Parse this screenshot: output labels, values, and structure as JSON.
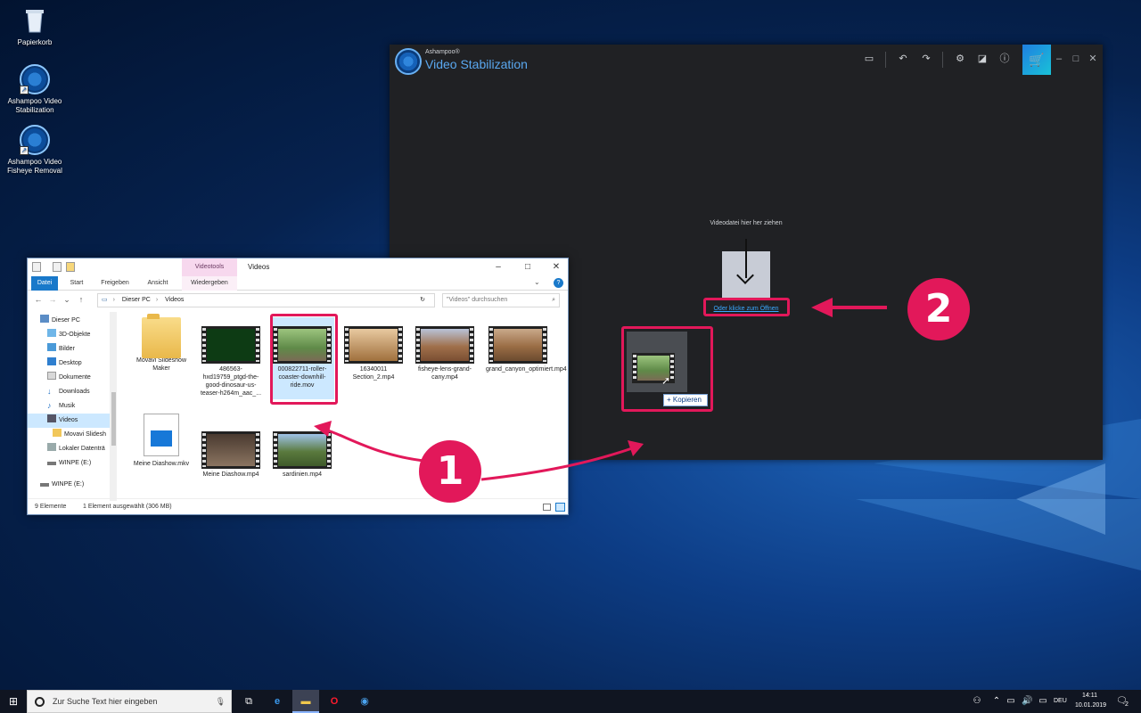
{
  "desktop": {
    "icons": [
      {
        "label": "Papierkorb"
      },
      {
        "label": "Ashampoo Video Stabilization"
      },
      {
        "label": "Ashampoo Video Fisheye Removal"
      }
    ]
  },
  "ashampoo": {
    "brand": "Ashampoo®",
    "title": "Video Stabilization",
    "drop_hint": "Videodatei hier her ziehen",
    "open_link": "Oder klicke zum Öffnen"
  },
  "drag": {
    "tooltip": "+ Kopieren"
  },
  "explorer": {
    "context_tab": "Videotools",
    "title": "Videos",
    "ribbon_tabs": [
      "Datei",
      "Start",
      "Freigeben",
      "Ansicht",
      "Wiedergeben"
    ],
    "address": [
      "Dieser PC",
      "Videos"
    ],
    "search_placeholder": "\"Videos\" durchsuchen",
    "nav_items": [
      "Dieser PC",
      "3D-Objekte",
      "Bilder",
      "Desktop",
      "Dokumente",
      "Downloads",
      "Musik",
      "Videos",
      "Movavi Slidesh",
      "Lokaler Datenträ",
      "WINPE (E:)",
      "WINPE (E:)"
    ],
    "files": [
      "Movavi Slideshow Maker",
      "486563-hxd19759_ptgd-the-good-dinosaur-us-teaser-h264m_aac_...",
      "000822711-roller-coaster-downhill-ride.mov",
      "16340011 Section_2.mp4",
      "fisheye-lens-grand-cany.mp4",
      "grand_canyon_optimiert.mp4",
      "Meine Diashow.mkv",
      "Meine Diashow.mp4",
      "sardinien.mp4"
    ],
    "status_count": "9 Elemente",
    "status_selected": "1 Element ausgewählt (306 MB)"
  },
  "annotations": {
    "badge1": "1",
    "badge2": "2",
    "accent": "#e2185a"
  },
  "taskbar": {
    "search_placeholder": "Zur Suche Text hier eingeben",
    "lang": "DEU",
    "time": "14:11",
    "date": "10.01.2019",
    "notif_count": "2"
  }
}
